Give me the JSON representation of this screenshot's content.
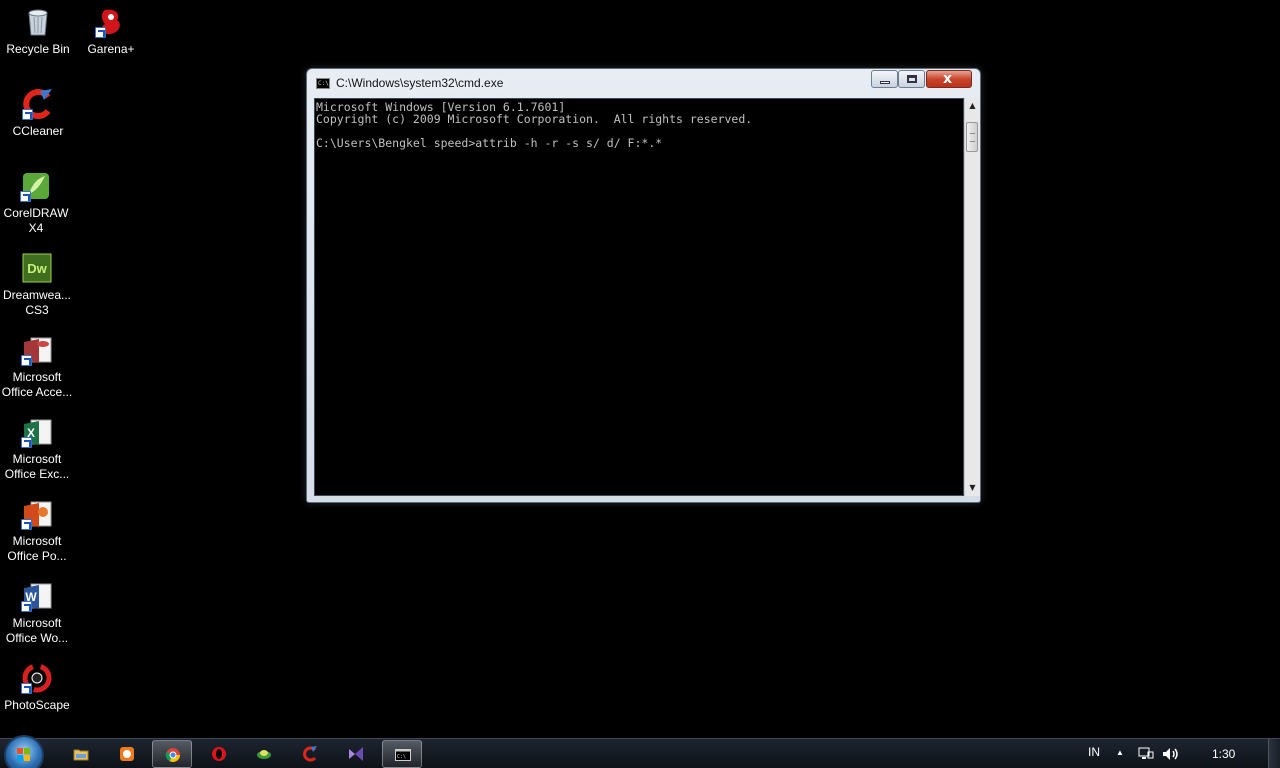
{
  "desktop_icons": [
    {
      "name": "recycle-bin",
      "label": "Recycle Bin"
    },
    {
      "name": "garena",
      "label": "Garena+"
    },
    {
      "name": "ccleaner",
      "label": "CCleaner"
    },
    {
      "name": "coreldraw",
      "label": "CorelDRAW\nX4"
    },
    {
      "name": "dreamweaver",
      "label": "Dreamwea...\nCS3"
    },
    {
      "name": "ms-access",
      "label": "Microsoft\nOffice Acce..."
    },
    {
      "name": "ms-excel",
      "label": "Microsoft\nOffice Exc..."
    },
    {
      "name": "ms-powerpoint",
      "label": "Microsoft\nOffice Po..."
    },
    {
      "name": "ms-word",
      "label": "Microsoft\nOffice Wo..."
    },
    {
      "name": "photoscape",
      "label": "PhotoScape"
    }
  ],
  "window": {
    "title": "C:\\Windows\\system32\\cmd.exe",
    "icon_text": "C:\\",
    "close_glyph": "x",
    "console_text": "Microsoft Windows [Version 6.1.7601]\nCopyright (c) 2009 Microsoft Corporation.  All rights reserved.\n\nC:\\Users\\Bengkel speed>attrib -h -r -s s/ d/ F:*.*",
    "scroll_up_glyph": "▲",
    "scroll_down_glyph": "▼"
  },
  "taskbar": {
    "items": [
      "windows-explorer",
      "photo-app",
      "google-chrome",
      "opera",
      "network-app",
      "ccleaner",
      "visual-studio",
      "command-prompt"
    ],
    "active_items": [
      "google-chrome",
      "command-prompt"
    ],
    "language": "IN",
    "tray_arrow": "▲",
    "clock": "1:30"
  },
  "colors": {
    "desktop": "#000000",
    "console_text": "#c0c0c0",
    "close_button": "#c8462c"
  }
}
